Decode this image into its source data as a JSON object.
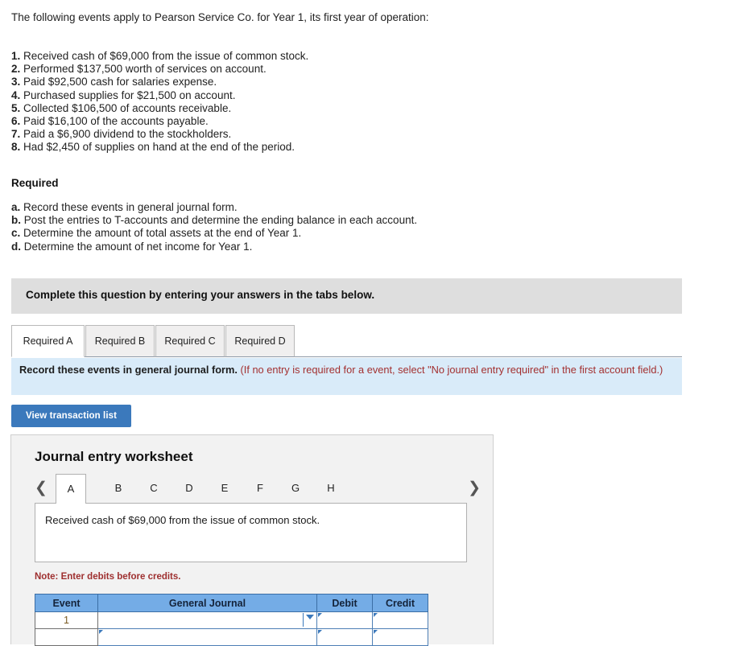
{
  "intro": "The following events apply to Pearson Service Co. for Year 1, its first year of operation:",
  "events": [
    {
      "num": "1.",
      "text": "Received cash of $69,000 from the issue of common stock."
    },
    {
      "num": "2.",
      "text": "Performed $137,500 worth of services on account."
    },
    {
      "num": "3.",
      "text": "Paid $92,500 cash for salaries expense."
    },
    {
      "num": "4.",
      "text": "Purchased supplies for $21,500 on account."
    },
    {
      "num": "5.",
      "text": "Collected $106,500 of accounts receivable."
    },
    {
      "num": "6.",
      "text": "Paid $16,100 of the accounts payable."
    },
    {
      "num": "7.",
      "text": "Paid a $6,900 dividend to the stockholders."
    },
    {
      "num": "8.",
      "text": "Had $2,450 of supplies on hand at the end of the period."
    }
  ],
  "required": {
    "heading": "Required",
    "items": [
      {
        "letter": "a.",
        "text": "Record these events in general journal form."
      },
      {
        "letter": "b.",
        "text": "Post the entries to T-accounts and determine the ending balance in each account."
      },
      {
        "letter": "c.",
        "text": "Determine the amount of total assets at the end of Year 1."
      },
      {
        "letter": "d.",
        "text": "Determine the amount of net income for Year 1."
      }
    ]
  },
  "instruction_bar": {
    "text": "Complete this question by entering your answers in the tabs below.",
    "background": "#dedede"
  },
  "tabs": [
    {
      "label": "Required A",
      "active": true
    },
    {
      "label": "Required B",
      "active": false
    },
    {
      "label": "Required C",
      "active": false
    },
    {
      "label": "Required D",
      "active": false
    }
  ],
  "banner": {
    "main": "Record these events in general journal form.",
    "paren": "(If no entry is required for a event, select \"No journal entry required\" in the first account field.)",
    "background": "#d9ebf9",
    "paren_color": "#a33030"
  },
  "view_transaction_button": {
    "label": "View transaction list",
    "color": "#3b79bc"
  },
  "worksheet": {
    "title": "Journal entry worksheet",
    "prev_icon": "chevron-left-icon",
    "next_icon": "chevron-right-icon",
    "letter_tabs": [
      {
        "label": "A",
        "active": true
      },
      {
        "label": "B",
        "active": false
      },
      {
        "label": "C",
        "active": false
      },
      {
        "label": "D",
        "active": false
      },
      {
        "label": "E",
        "active": false
      },
      {
        "label": "F",
        "active": false
      },
      {
        "label": "G",
        "active": false
      },
      {
        "label": "H",
        "active": false
      }
    ],
    "description": "Received cash of $69,000 from the issue of common stock.",
    "note": "Note: Enter debits before credits.",
    "table": {
      "headers": [
        "Event",
        "General Journal",
        "Debit",
        "Credit"
      ],
      "header_color": "#74ace6",
      "rows": [
        {
          "event": "1",
          "general_journal": "",
          "debit": "",
          "credit": ""
        },
        {
          "event": "",
          "general_journal": "",
          "debit": "",
          "credit": ""
        }
      ]
    }
  }
}
